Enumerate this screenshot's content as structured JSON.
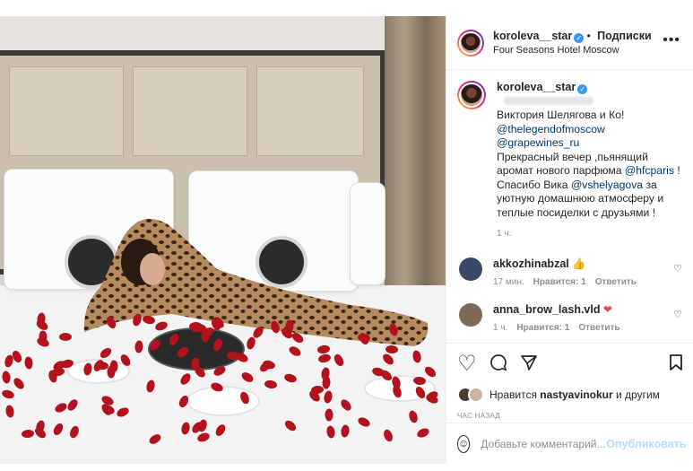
{
  "header": {
    "username": "koroleva__star",
    "follow_label": "Подписки",
    "location": "Four Seasons Hotel Moscow",
    "more_label": "•••"
  },
  "caption": {
    "username": "koroleva__star",
    "line1": "Виктория Шелягова и Ко!",
    "mention1": "@thelegendofmoscow",
    "mention2": "@grapewines_ru",
    "text1": "Прекрасный вечер ,пьянящий аромат нового парфюма ",
    "mention3": "@hfcparis",
    "text2": " ! Спасибо Вика ",
    "mention4": "@vshelyagova",
    "text3": " за уютную домашнюю атмосферу и теплые посиделки с друзьями !",
    "time": "1 ч."
  },
  "comments": [
    {
      "username": "akkozhinabzal",
      "text": "👍",
      "time": "17 мин.",
      "likes": "Нравится: 1",
      "reply": "Ответить",
      "avatar_color": "#3a4a66"
    },
    {
      "username": "anna_brow_lash.vld",
      "text": "❤",
      "time": "1 ч.",
      "likes": "Нравится: 1",
      "reply": "Ответить",
      "avatar_color": "#7d6a57"
    }
  ],
  "actions": {
    "like_icon": "♡",
    "comment_icon": "◯",
    "share_icon": "➤",
    "bookmark_icon": "⊓"
  },
  "likes": {
    "prefix": "Нравится ",
    "username": "nastyavinokur",
    "suffix": " и другим"
  },
  "ago": "ЧАС НАЗАД",
  "add_comment": {
    "emoji_icon": "☺",
    "placeholder": "Добавьте комментарий...",
    "publish_label": "Опубликовать"
  },
  "colors": {
    "verified": "#3897f0",
    "link": "#00376b",
    "publish_disabled": "#b2dffc",
    "petal": "#b3121c"
  }
}
